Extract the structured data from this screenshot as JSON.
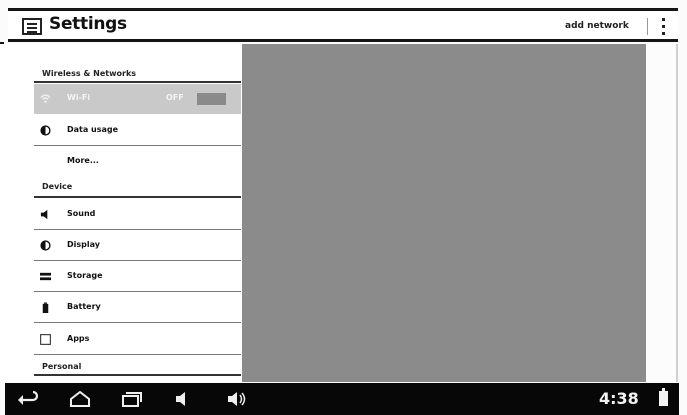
{
  "actionbar": {
    "title": "Settings",
    "app_icon": "settings-list-icon",
    "add_network_label": "add network",
    "overflow_icon": "overflow-menu-icon"
  },
  "sidebar": {
    "categories": {
      "wireless": "Wireless & Networks",
      "device": "Device",
      "personal": "Personal"
    },
    "items": [
      {
        "label": "Wi-Fi",
        "icon": "wifi-icon",
        "toggle": "OFF",
        "selected": true
      },
      {
        "label": "Data usage",
        "icon": "data-usage-icon"
      },
      {
        "label": "More..."
      },
      {
        "label": "Sound",
        "icon": "speaker-icon"
      },
      {
        "label": "Display",
        "icon": "display-icon"
      },
      {
        "label": "Storage",
        "icon": "storage-icon"
      },
      {
        "label": "Battery",
        "icon": "battery-icon"
      },
      {
        "label": "Apps",
        "icon": "apps-icon"
      }
    ]
  },
  "navbar": {
    "buttons": [
      "back-icon",
      "home-icon",
      "recent-apps-icon",
      "volume-down-icon",
      "volume-up-icon"
    ],
    "clock": "4:38",
    "status_icon": "battery-status-icon"
  },
  "colors": {
    "detail_pane": "#8b8b8b",
    "selected_row": "#c9c9c9",
    "navbar": "#070707"
  }
}
